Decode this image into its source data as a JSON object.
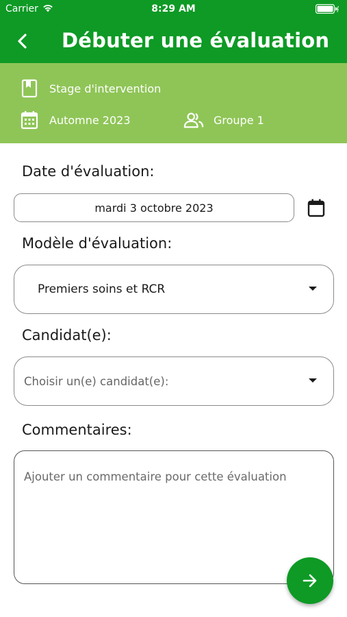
{
  "status_bar": {
    "carrier": "Carrier",
    "time": "8:29 AM",
    "wifi_icon": "wifi-icon",
    "battery_icon": "battery-charging-icon"
  },
  "header": {
    "title": "Débuter une évaluation",
    "back_icon": "chevron-left-icon"
  },
  "info_banner": {
    "course": "Stage d'intervention",
    "term": "Automne 2023",
    "group": "Groupe 1",
    "icons": [
      "bookmark-book-icon",
      "calendar-icon",
      "group-people-icon"
    ]
  },
  "form": {
    "date_label": "Date d'évaluation:",
    "date_value": "mardi 3 octobre 2023",
    "model_label": "Modèle d'évaluation:",
    "model_value": "Premiers soins et RCR",
    "candidate_label": "Candidat(e):",
    "candidate_placeholder": "Choisir un(e) candidat(e):",
    "comments_label": "Commentaires:",
    "comments_placeholder": "Ajouter un commentaire pour cette évaluation"
  },
  "fab": {
    "icon": "arrow-right-icon"
  },
  "colors": {
    "primary": "#0e9a25",
    "banner": "#8fc557"
  }
}
